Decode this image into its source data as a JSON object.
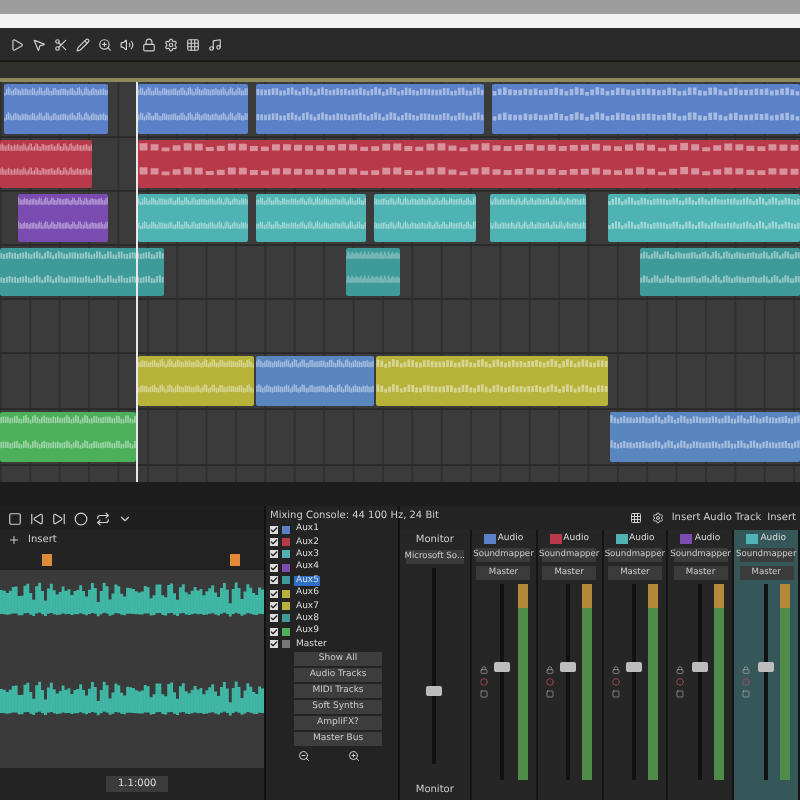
{
  "tracks": [
    {
      "clips": [
        {
          "color": "#5b82c8"
        },
        {
          "color": "#5b82c8"
        },
        {
          "color": "#5b82c8"
        },
        {
          "color": "#5b82c8"
        }
      ]
    },
    {
      "clips": [
        {
          "color": "#b8394a"
        },
        {
          "color": "#b8394a"
        }
      ]
    },
    {
      "clips": [
        {
          "color": "#7a4bb0"
        },
        {
          "color": "#4fb3b3"
        },
        {
          "color": "#4fb3b3"
        },
        {
          "color": "#4fb3b3"
        },
        {
          "color": "#4fb3b3"
        },
        {
          "color": "#4fb3b3"
        }
      ]
    },
    {
      "clips": [
        {
          "color": "#3f9a9a"
        },
        {
          "color": "#3f9a9a"
        },
        {
          "color": "#3f9a9a"
        }
      ]
    },
    {
      "clips": [
        {
          "color": "#b6b23a"
        },
        {
          "color": "#5a86c0"
        },
        {
          "color": "#b6b23a"
        }
      ]
    },
    {
      "clips": [
        {
          "color": "#4caf5a"
        },
        {
          "color": "#5a86c0"
        }
      ]
    }
  ],
  "editor": {
    "insert_label": "Insert",
    "position": "1.1:000"
  },
  "mixer": {
    "title": "Mixing Console: 44 100 Hz, 24 Bit",
    "channels": [
      {
        "name": "Aux1",
        "color": "#5b82c8",
        "checked": true,
        "selected": false
      },
      {
        "name": "Aux2",
        "color": "#b8394a",
        "checked": true,
        "selected": false
      },
      {
        "name": "Aux3",
        "color": "#4fb3b3",
        "checked": true,
        "selected": false
      },
      {
        "name": "Aux4",
        "color": "#7a4bb0",
        "checked": true,
        "selected": false
      },
      {
        "name": "Aux5",
        "color": "#3f9a9a",
        "checked": true,
        "selected": true
      },
      {
        "name": "Aux6",
        "color": "#b6b23a",
        "checked": true,
        "selected": false
      },
      {
        "name": "Aux7",
        "color": "#b6b23a",
        "checked": true,
        "selected": false
      },
      {
        "name": "Aux8",
        "color": "#3f9a9a",
        "checked": true,
        "selected": false
      },
      {
        "name": "Aux9",
        "color": "#4caf5a",
        "checked": true,
        "selected": false
      },
      {
        "name": "Master",
        "color": "#777777",
        "checked": true,
        "selected": false
      }
    ],
    "filters": [
      "Show All",
      "Audio Tracks",
      "MIDI Tracks",
      "Soft Synths",
      "AmpliFX?",
      "Master Bus"
    ],
    "toolbar": [
      "Insert Audio Track",
      "Insert"
    ],
    "monitor": {
      "label": "Monitor",
      "input": "Microsoft So...",
      "footer": "Monitor",
      "level": 0.35
    },
    "strips": [
      {
        "type": "Audio",
        "color": "#5b82c8",
        "input": "Soundmapper",
        "output": "Master",
        "selected": false,
        "level": 0.55
      },
      {
        "type": "Audio",
        "color": "#b8394a",
        "input": "Soundmapper",
        "output": "Master",
        "selected": false,
        "level": 0.55
      },
      {
        "type": "Audio",
        "color": "#4fb3b3",
        "input": "Soundmapper",
        "output": "Master",
        "selected": false,
        "level": 0.55
      },
      {
        "type": "Audio",
        "color": "#7a4bb0",
        "input": "Soundmapper",
        "output": "Master",
        "selected": false,
        "level": 0.55
      },
      {
        "type": "Audio",
        "color": "#4fb3b3",
        "input": "Soundmapper",
        "output": "Master",
        "selected": true,
        "level": 0.55
      }
    ]
  }
}
